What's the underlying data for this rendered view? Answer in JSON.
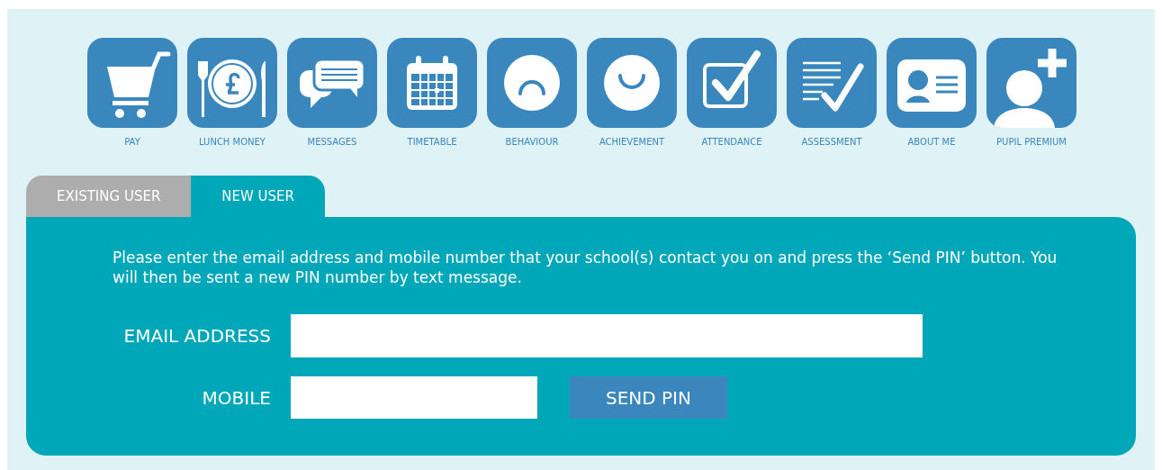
{
  "menu": [
    {
      "label": "PAY",
      "kind": "cart"
    },
    {
      "label": "LUNCH MONEY",
      "kind": "plate"
    },
    {
      "label": "MESSAGES",
      "kind": "chat"
    },
    {
      "label": "TIMETABLE",
      "kind": "calendar"
    },
    {
      "label": "BEHAVIOUR",
      "kind": "frown"
    },
    {
      "label": "ACHIEVEMENT",
      "kind": "smile"
    },
    {
      "label": "ATTENDANCE",
      "kind": "checkbox"
    },
    {
      "label": "ASSESSMENT",
      "kind": "checklist"
    },
    {
      "label": "ABOUT ME",
      "kind": "idcard"
    },
    {
      "label": "PUPIL PREMIUM",
      "kind": "personplus"
    }
  ],
  "tabs": [
    {
      "label": "EXISTING USER",
      "selected": false
    },
    {
      "label": "NEW USER",
      "selected": true
    }
  ],
  "intro": "Please enter the email address and mobile number that your school(s) contact you on and press the ‘Send PIN’ button. You will then be sent a new PIN number by text message.",
  "fields": [
    {
      "label": "EMAIL ADDRESS",
      "kind": "wide"
    },
    {
      "label": "MOBILE",
      "kind": "short"
    }
  ],
  "button": "SEND PIN"
}
